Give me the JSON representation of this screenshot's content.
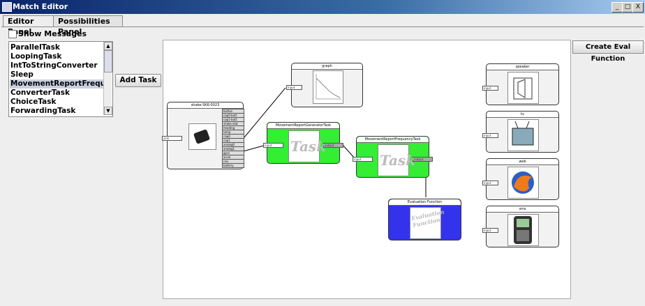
{
  "window": {
    "title": "Match Editor",
    "controls": [
      "_",
      "□",
      "X"
    ]
  },
  "tabs": [
    {
      "label": "Editor Panel",
      "active": true
    },
    {
      "label": "Possibilities Panel",
      "active": false
    }
  ],
  "show_messages": {
    "label": "Show Messages",
    "checked": false
  },
  "task_list": {
    "items": [
      "ParallelTask",
      "LoopingTask",
      "IntToStringConverter",
      "Sleep",
      "MovementReportFrequencyTask",
      "ConverterTask",
      "ChoiceTask",
      "ForwardingTask"
    ],
    "selected_index": 4
  },
  "add_task_label": "Add Task",
  "create_eval_label": "Create Eval Function",
  "nodes": {
    "graph": {
      "title": "graph",
      "ports": [
        "input"
      ]
    },
    "shake": {
      "title": "shake-SK6-0023",
      "in_port": "sink",
      "out_ports": [
        "button",
        "cap0-butt",
        "cap1-butt",
        "shake-stat",
        "heading",
        "temp",
        "cap0",
        "cap1",
        "analog0",
        "analog1",
        "gyro",
        "accel",
        "nav",
        "battery"
      ]
    },
    "mrg": {
      "title": "MovementReportGeneratorTask",
      "in": "input",
      "out": "output",
      "label": "Task"
    },
    "mrf": {
      "title": "MovementReportFrequencyTask",
      "in": "input",
      "out": "output",
      "label": "Task"
    },
    "eval": {
      "title": "Evaluation Function",
      "label": "Evaluation Function"
    },
    "speaker": {
      "title": "speaker",
      "port": "input"
    },
    "tv": {
      "title": "tv",
      "port": "input"
    },
    "web": {
      "title": "web",
      "port": "input"
    },
    "sms": {
      "title": "sms",
      "port": "input"
    }
  },
  "colors": {
    "task_green": "#33ee33",
    "eval_blue": "#3333ee",
    "title_bar": "#0a246a"
  }
}
